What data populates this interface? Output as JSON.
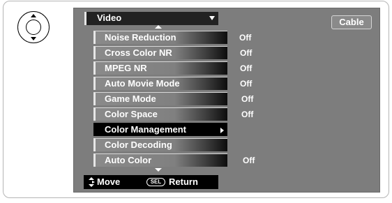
{
  "header": {
    "title": "Video",
    "input_label": "Cable"
  },
  "menu": {
    "items": [
      {
        "label": "Noise Reduction",
        "value": "Off",
        "selected": false
      },
      {
        "label": "Cross Color NR",
        "value": "Off",
        "selected": false
      },
      {
        "label": "MPEG NR",
        "value": "Off",
        "selected": false
      },
      {
        "label": "Auto Movie Mode",
        "value": "Off",
        "selected": false
      },
      {
        "label": "Game Mode",
        "value": "Off",
        "selected": false
      },
      {
        "label": "Color Space",
        "value": "Off",
        "selected": false
      },
      {
        "label": "Color Management",
        "value": "",
        "selected": true
      },
      {
        "label": "Color Decoding",
        "value": "",
        "selected": false
      },
      {
        "label": "Auto Color",
        "value": "Off",
        "selected": false
      }
    ]
  },
  "footer": {
    "move_label": "Move",
    "sel_label": "SEL",
    "return_label": "Return"
  },
  "icons": {
    "remote": "remote-dpad-icon",
    "dropdown": "chevron-down-icon",
    "scroll_up": "scroll-up-icon",
    "scroll_down": "scroll-down-icon",
    "submenu": "chevron-right-icon",
    "nav": "up-down-arrows-icon"
  },
  "colors": {
    "panel": "#7d7d7d",
    "selected_bg": "#000000",
    "text": "#ffffff"
  }
}
